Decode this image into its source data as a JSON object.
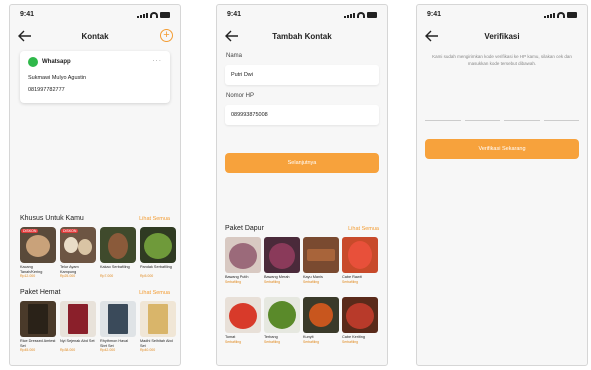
{
  "status": {
    "time": "9:41"
  },
  "screen1": {
    "title": "Kontak",
    "contact": {
      "app": "Whatsapp",
      "name": "Sukmawi Mulyo Agustin",
      "phone": "081997782777",
      "more": "..."
    },
    "section1": {
      "title": "Khusus Untuk Kamu",
      "link": "Lihat Semua",
      "items": [
        {
          "name": "Kacang Tanah/Kering",
          "sub": "Rp12.000",
          "tag": "DISKON"
        },
        {
          "name": "Telur Ayam Kampung",
          "sub": "Rp25.000",
          "tag": "DISKON"
        },
        {
          "name": "Kakao Serbafiling",
          "sub": "Rp7.000",
          "tag": ""
        },
        {
          "name": "Pandak Serbafiling",
          "sub": "Rp5.000",
          "tag": ""
        }
      ]
    },
    "section2": {
      "title": "Paket Hemat",
      "link": "Lihat Semua",
      "items": [
        {
          "name": "Rice Dressed Amtest Set",
          "sub": "Rp45.000"
        },
        {
          "name": "Nyi Sejenak Abd Set",
          "sub": "Rp38.000"
        },
        {
          "name": "Rhythmon Haval Sbrt Set",
          "sub": "Rp42.000"
        },
        {
          "name": "Madhi Selhitah Abd Set",
          "sub": "Rp40.000"
        }
      ]
    }
  },
  "screen2": {
    "title": "Tambah Kontak",
    "name_label": "Nama",
    "name_value": "Putri Dwi",
    "phone_label": "Nomor HP",
    "phone_value": "089993875008",
    "button": "Selanjutnya",
    "section": {
      "title": "Paket Dapur",
      "link": "Lihat Semua",
      "row1": [
        {
          "name": "Bawang Putih",
          "sub": "Serbafiling"
        },
        {
          "name": "Bawang Merah",
          "sub": "Serbafiling"
        },
        {
          "name": "Kayu Manis",
          "sub": "Serbafiling"
        },
        {
          "name": "Cabe Rawit",
          "sub": "Serbafiling"
        }
      ],
      "row2": [
        {
          "name": "Tomat",
          "sub": "Serbafiling"
        },
        {
          "name": "Terbang",
          "sub": "Serbafiling"
        },
        {
          "name": "Kunyit",
          "sub": "Serbafiling"
        },
        {
          "name": "Cabe Keriting",
          "sub": "Serbafiling"
        }
      ]
    }
  },
  "screen3": {
    "title": "Verifikasi",
    "description": "Kami sudah mengirimkan kode verifikasi ke HP kamu, silakan cek dan masukkan kode tersebut dibawah.",
    "button": "Verifikasi Sekarang"
  },
  "colors": {
    "accent": "#f39c33",
    "whatsapp": "#2fb84a",
    "button": "#f7a23c"
  }
}
